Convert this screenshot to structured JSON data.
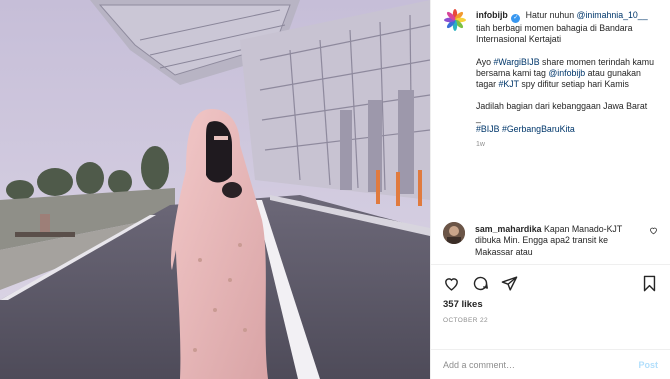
{
  "post": {
    "username": "infobijb",
    "verified": true,
    "caption_line1": "Hatur nuhun",
    "caption_mention": "@inimahnia_10__",
    "caption_line2": "tiah berbagi momen bahagia di Bandara Internasional Kertajati",
    "caption_p2_a": "Ayo ",
    "caption_p2_tag1": "#WargiBIJB",
    "caption_p2_b": " share momen terindah kamu bersama kami tag ",
    "caption_p2_mention": "@infobijb",
    "caption_p2_c": " atau gunakan tagar ",
    "caption_p2_tag2": "#KJT",
    "caption_p2_d": " spy difitur setiap hari Kamis",
    "caption_p3": "Jadilah bagian dari kebanggaan Jawa Barat",
    "caption_sep": "_",
    "caption_tag3": "#BIJB",
    "caption_tag4": "#GerbangBaruKita",
    "time_ago": "1w"
  },
  "comment": {
    "username": "sam_mahardika",
    "text": "Kapan Manado-KJT dibuka Min. Engga apa2 transit ke Makassar atau"
  },
  "actions": {
    "icons": [
      "heart-icon",
      "comment-icon",
      "share-icon",
      "bookmark-icon"
    ],
    "likes": "357 likes",
    "date": "OCTOBER 22"
  },
  "add_comment": {
    "placeholder": "Add a comment…",
    "post_label": "Post"
  },
  "colors": {
    "link": "#00376b",
    "verified": "#3897f0",
    "post_button": "#b2dffc",
    "muted": "#8e8e8e"
  }
}
